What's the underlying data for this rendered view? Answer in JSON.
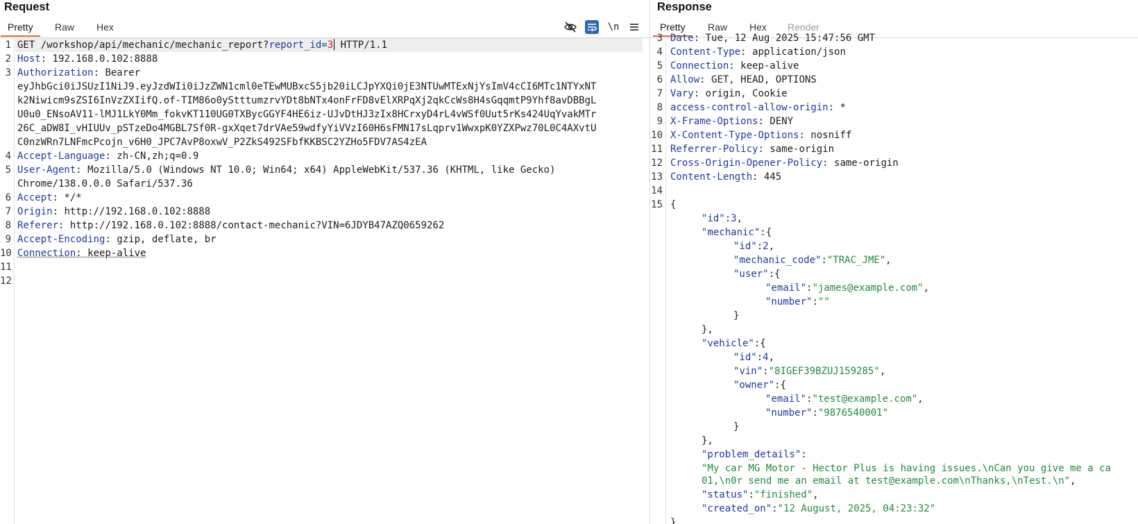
{
  "request": {
    "title": "Request",
    "tabs": [
      "Pretty",
      "Raw",
      "Hex"
    ],
    "active_tab": "Pretty",
    "tools": {
      "hide_icon": "eye-slash-icon",
      "wrap_icon": "wrap-lines-icon",
      "newline_label": "\\n",
      "menu_icon": "menu-icon"
    },
    "line_numbers": [
      "1",
      "2",
      "3",
      "4",
      "5",
      "6",
      "7",
      "8",
      "9",
      "10",
      "11",
      "12"
    ],
    "request_line": {
      "method_path": "GET /workshop/api/mechanic/mechanic_report?",
      "param_name": "report_id",
      "equals": "=",
      "param_value": "3",
      "version": " HTTP/1.1"
    },
    "headers": {
      "host": {
        "name": "Host",
        "value": " 192.168.0.102:8888"
      },
      "auth": {
        "name": "Authorization",
        "value": " Bearer"
      },
      "token": [
        "eyJhbGci0iJSUzI1NiJ9.eyJzdWIi0iJzZWN1cml0eTEwMUBxcS5jb20iLCJpYXQi0jE3NTUwMTExNjYsImV4cCI6MTc1NTYxNT",
        "k2Niwicm9sZSI6InVzZXIifQ.of-TIM86o0yStttumzrvYDt8bNTx4onFrFD8vElXRPqXj2qkCcWs8H4sGqqmtP9Yhf8avDBBgL",
        "U0u0_ENsoAV11-lMJ1LkY0Mm_fokvKT110UG0TXBycGGYF4HE6iz-UJvDtHJ3zIx8HCrxyD4rL4vWSf0Uut5rKs424UqYvakMTr",
        "26C_aDW8I_vHIUUv_pSTzeDo4MGBL7Sf0R-gxXqet7drVAe59wdfyYiVVzI60H6sFMN17sLqprv1WwxpK0YZXPwz70L0C4AXvtU",
        "C0nzWRn7LNFmcPcojn_v6H0_JPC7AvP8oxwV_P2ZkS492SFbfKKBSC2YZHo5FDV7AS4zEA"
      ],
      "accept_language": {
        "name": "Accept-Language",
        "value": " zh-CN,zh;q=0.9"
      },
      "user_agent": {
        "name": "User-Agent",
        "value": " Mozilla/5.0 (Windows NT 10.0; Win64; x64) AppleWebKit/537.36 (KHTML, like Gecko)",
        "cont": "Chrome/138.0.0.0 Safari/537.36"
      },
      "accept": {
        "name": "Accept",
        "value": " */*"
      },
      "origin": {
        "name": "Origin",
        "value": " http://192.168.0.102:8888"
      },
      "referer": {
        "name": "Referer",
        "value": " http://192.168.0.102:8888/contact-mechanic?VIN=6JDYB47AZQ0659262"
      },
      "accept_encoding": {
        "name": "Accept-Encoding",
        "value": " gzip, deflate, br"
      },
      "connection": {
        "name": "Connection",
        "value": " keep-alive"
      }
    }
  },
  "response": {
    "title": "Response",
    "tabs": [
      "Pretty",
      "Raw",
      "Hex",
      "Render"
    ],
    "active_tab": "Pretty",
    "line_numbers": [
      "3",
      "4",
      "5",
      "6",
      "7",
      "8",
      "9",
      "10",
      "11",
      "12",
      "13",
      "14",
      "15"
    ],
    "headers": {
      "date": {
        "name": "Date",
        "value": " Tue, 12 Aug 2025 15:47:56 GMT"
      },
      "content_type": {
        "name": "Content-Type",
        "value": " application/json"
      },
      "connection": {
        "name": "Connection",
        "value": " keep-alive"
      },
      "allow": {
        "name": "Allow",
        "value": " GET, HEAD, OPTIONS"
      },
      "vary": {
        "name": "Vary",
        "value": " origin, Cookie"
      },
      "acao": {
        "name": "access-control-allow-origin",
        "value": " *"
      },
      "xfo": {
        "name": "X-Frame-Options",
        "value": " DENY"
      },
      "xcto": {
        "name": "X-Content-Type-Options",
        "value": " nosniff"
      },
      "referrer_policy": {
        "name": "Referrer-Policy",
        "value": " same-origin"
      },
      "coop": {
        "name": "Cross-Origin-Opener-Policy",
        "value": " same-origin"
      },
      "content_length": {
        "name": "Content-Length",
        "value": " 445"
      }
    },
    "json": {
      "open": "{",
      "id_key": "\"id\"",
      "id_val": "3",
      "mechanic_key": "\"mechanic\"",
      "m_id_key": "\"id\"",
      "m_id_val": "2",
      "m_code_key": "\"mechanic_code\"",
      "m_code_val": "\"TRAC_JME\"",
      "user_key": "\"user\"",
      "u_email_key": "\"email\"",
      "u_email_val": "\"james@example.com\"",
      "u_number_key": "\"number\"",
      "u_number_val": "\"\"",
      "vehicle_key": "\"vehicle\"",
      "v_id_key": "\"id\"",
      "v_id_val": "4",
      "v_vin_key": "\"vin\"",
      "v_vin_val": "\"8IGEF39BZUJ159285\"",
      "owner_key": "\"owner\"",
      "o_email_key": "\"email\"",
      "o_email_val": "\"test@example.com\"",
      "o_number_key": "\"number\"",
      "o_number_val": "\"9876540001\"",
      "problem_key": "\"problem_details\"",
      "problem_val_1": "\"My car MG Motor - Hector Plus is having issues.\\nCan you give me a ca",
      "problem_val_2": "01,\\n0r send me an email at test@example.com\\nThanks,\\nTest.\\n\"",
      "status_key": "\"status\"",
      "status_val": "\"finished\"",
      "created_key": "\"created_on\"",
      "created_val": "\"12 August, 2025, 04:23:32\"",
      "close": "}"
    }
  }
}
